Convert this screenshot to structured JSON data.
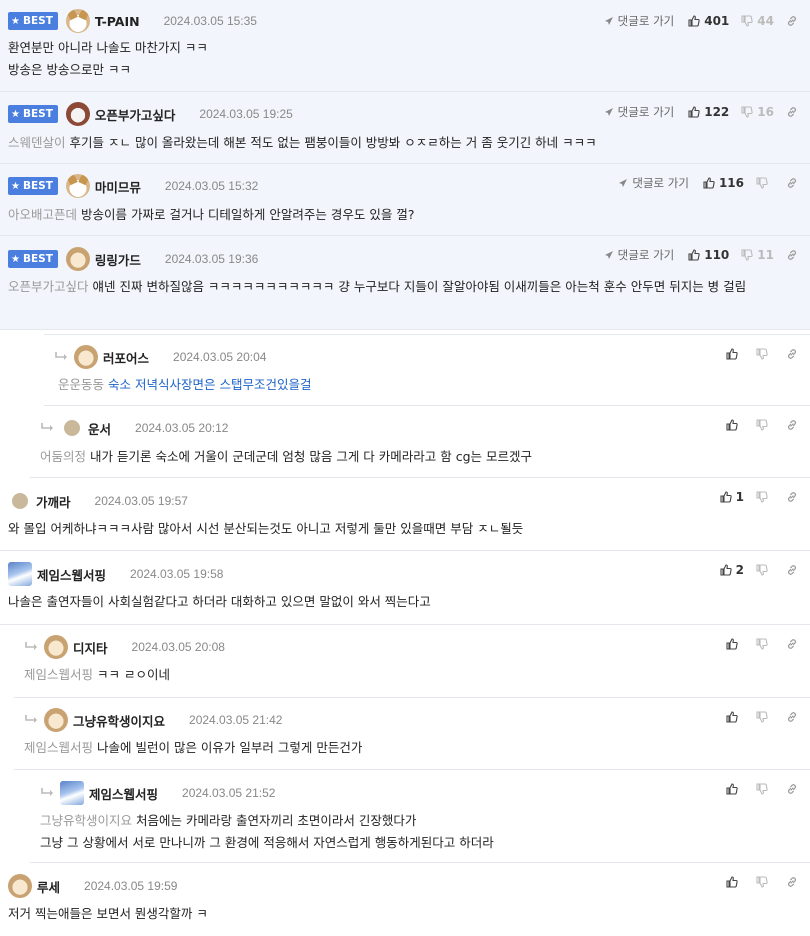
{
  "labels": {
    "best": "BEST",
    "reply_to": "댓글로 가기"
  },
  "colors": {
    "best_bg": "#4a7fe0",
    "best_row_bg": "#f2f5fb",
    "mention": "#999999",
    "link": "#1e63c8"
  },
  "comments": [
    {
      "nick": "T-PAIN",
      "date": "2024.03.05 15:35",
      "best": true,
      "avatar": "white-dog-avatar",
      "up": "401",
      "down": "44",
      "line1": "환연분만 아니라 나솔도 마찬가지 ㅋㅋ",
      "line2": "방송은 방송으로만 ㅋㅋ"
    },
    {
      "nick": "오픈부가고싶다",
      "date": "2024.03.05 19:25",
      "best": true,
      "avatar": "bear-avatar",
      "up": "122",
      "down": "16",
      "mention": "스웨덴살이",
      "text": "후기들 ㅈㄴ 많이 올라왔는데 해본 적도 없는 팸붕이들이 방방봐 ㅇㅈㄹ하는 거 좀 웃기긴 하네 ㅋㅋㅋ"
    },
    {
      "nick": "마미므뮤",
      "date": "2024.03.05 15:32",
      "best": true,
      "avatar": "white-dog-avatar",
      "up": "116",
      "down": "",
      "mention": "아오배고픈데",
      "text": "방송이름 가짜로 걸거나 디테일하게 안알려주는 경우도 있을 껄?"
    },
    {
      "nick": "링링가드",
      "date": "2024.03.05 19:36",
      "best": true,
      "avatar": "puppy-avatar",
      "up": "110",
      "down": "11",
      "mention": "오픈부가고싶다",
      "text": "얘넨 진짜 변하질않음 ㅋㅋㅋㅋㅋㅋㅋㅋㅋㅋㅋ 걍 누구보다 지들이 잘알아야됨 이새끼들은 아는척 훈수 안두면 뒤지는 병 걸림"
    },
    {
      "nick": "러포어스",
      "date": "2024.03.05 20:04",
      "avatar": "puppy-avatar",
      "mention": "운운동동",
      "text": "숙소 저녁식사장면은 스탭무조건있을걸"
    },
    {
      "nick": "운서",
      "date": "2024.03.05 20:12",
      "avatar": "dot-avatar",
      "mention": "어둠의정",
      "text": "내가 듣기론 숙소에 거울이 군데군데 엄청 많음 그게 다 카메라라고 함 cg는 모르겠구"
    },
    {
      "nick": "가깨라",
      "date": "2024.03.05 19:57",
      "avatar": "dot-avatar",
      "up": "1",
      "text": "와 몰입 어케하냐ㅋㅋㅋ사람 많아서 시선 분산되는것도 아니고 저렇게 둘만 있을때면 부담 ㅈㄴ될듯"
    },
    {
      "nick": "제임스웹서핑",
      "date": "2024.03.05 19:58",
      "avatar": "ghost-avatar",
      "up": "2",
      "text": "나솔은 출연자들이 사회실험같다고 하더라 대화하고 있으면 말없이 와서 찍는다고"
    },
    {
      "nick": "디지타",
      "date": "2024.03.05 20:08",
      "avatar": "puppy-avatar",
      "mention": "제임스웹서핑",
      "text": "ㅋㅋ ㄹㅇ이네"
    },
    {
      "nick": "그냥유학생이지요",
      "date": "2024.03.05 21:42",
      "avatar": "puppy-avatar",
      "mention": "제임스웹서핑",
      "text": "나솔에 빌런이 많은 이유가 일부러 그렇게 만든건가"
    },
    {
      "nick": "제임스웹서핑",
      "date": "2024.03.05 21:52",
      "avatar": "ghost-avatar",
      "mention": "그냥유학생이지요",
      "line1": "처음에는 카메라랑 출연자끼리 초면이라서 긴장했다가",
      "line2": "그냥 그 상황에서 서로 만나니까 그 환경에 적응해서 자연스럽게 행동하게된다고 하더라"
    },
    {
      "nick": "루세",
      "date": "2024.03.05 19:59",
      "avatar": "puppy-avatar",
      "text": "저거 찍는애들은 보면서 뭔생각할까 ㅋ"
    }
  ]
}
